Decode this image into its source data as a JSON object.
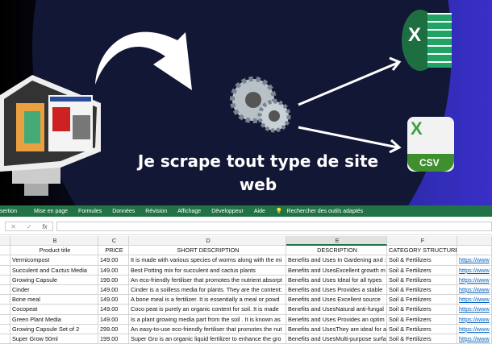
{
  "hero": {
    "title_line1": "Je scrape tout type de site",
    "title_line2": "web",
    "csv_label": "CSV",
    "excel_label": "X"
  },
  "ribbon": {
    "tabs": [
      "sertion",
      "Mise en page",
      "Formules",
      "Données",
      "Révision",
      "Affichage",
      "Développeur",
      "Aide"
    ],
    "search": "Rechercher des outils adaptés"
  },
  "formula_bar": {
    "cancel": "✕",
    "enter": "✓",
    "fx": "fx"
  },
  "columns": [
    "B",
    "C",
    "D",
    "E",
    "F"
  ],
  "headers": [
    "Product title",
    "PRICE",
    "SHORT DESCRIPTION",
    "DESCRIPTION",
    "CATEGORY STRUCTURE"
  ],
  "rows": [
    [
      "Vermicompost",
      "149.00",
      "It is made with various species of worms along with the mi",
      "Benefits and Uses In Gardening and :",
      "Soil & Fertilizers",
      "https://www"
    ],
    [
      "Succulent and Cactus Media",
      "149.00",
      "Best Potting mix for succulent and cactus plants",
      "Benefits and UsesExcellent growth m",
      "Soil & Fertilizers",
      "https://www"
    ],
    [
      "Growing Capsule",
      "199.00",
      "An eco-friendly fertiliser that promotes the nutrient absorpt",
      "Benefits and Uses Ideal for all types",
      "Soil & Fertilizers",
      "https://www"
    ],
    [
      "Cinder",
      "149.00",
      "Cinder is a soilless media for plants. They are the content:",
      "Benefits and Uses Provides a stable",
      "Soil & Fertilizers",
      "https://www"
    ],
    [
      "Bone meal",
      "149.00",
      "A bone meal is a fertilizer. It is essentially a meal or powd",
      "Benefits and Uses Excellent source",
      "Soil & Fertilizers",
      "https://www"
    ],
    [
      "Cocopeat",
      "149.00",
      "Coco peat is purely an organic content for soil. It is made",
      "Benefits and UsesNatural anti-fungal",
      "Soil & Fertilizers",
      "https://www"
    ],
    [
      "Green Plant Media",
      "149.00",
      "Is a plant growing media part from the soil . It is known as",
      "Benefits and Uses Provides an optim",
      "Soil & Fertilizers",
      "https://www"
    ],
    [
      "Growing Capsule Set of 2",
      "299.00",
      "An easy-to-use eco-friendly fertiliser that promotes the nut",
      "Benefits and UsesThey are ideal for a",
      "Soil & Fertilizers",
      "https://www"
    ],
    [
      "Super Grow 50ml",
      "199.00",
      "Super Gro is an organic liquid fertilizer to enhance the gro",
      "Benefits and UsesMulti-purpose surfa",
      "Soil & Fertilizers",
      "https://www"
    ]
  ]
}
